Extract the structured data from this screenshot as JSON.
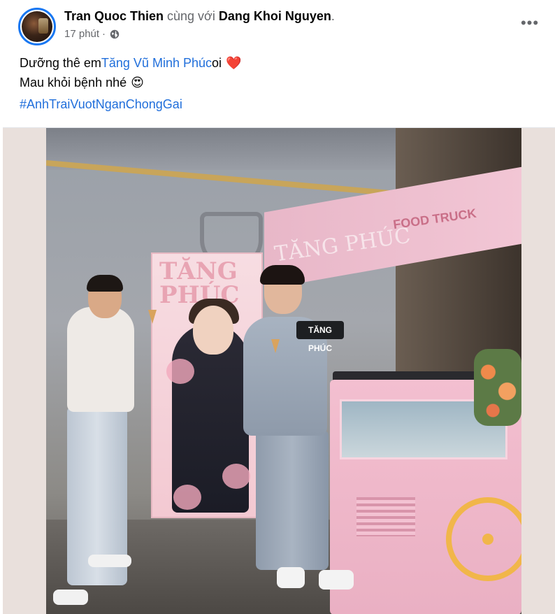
{
  "post": {
    "author": "Tran Quoc Thien",
    "with_text": " cùng với ",
    "tagged": "Dang Khoi Nguyen",
    "tagged_suffix": ".",
    "time": "17 phút",
    "dot": "·",
    "privacy_icon": "globe-icon",
    "more_label": "•••",
    "text_line1_prefix": "Dưỡng thê em ",
    "mention": "Tăng Vũ Minh Phúc",
    "text_line1_suffix": " oi",
    "emoji1": "❤️",
    "text_line2": "Mau khỏi bệnh nhé",
    "emoji2": "😍",
    "hashtag": "#AnhTraiVuotNganChongGai"
  },
  "photo": {
    "banner_text": "TĂNG\nPHÚC",
    "truck_text": "TĂNG PHÚC",
    "truck_sub": "FOOD TRUCK",
    "sign_text": "TĂNG PHÚC"
  },
  "colors": {
    "link": "#216fdb",
    "secondary": "#65676b",
    "avatar_ring": "#1877f2"
  }
}
